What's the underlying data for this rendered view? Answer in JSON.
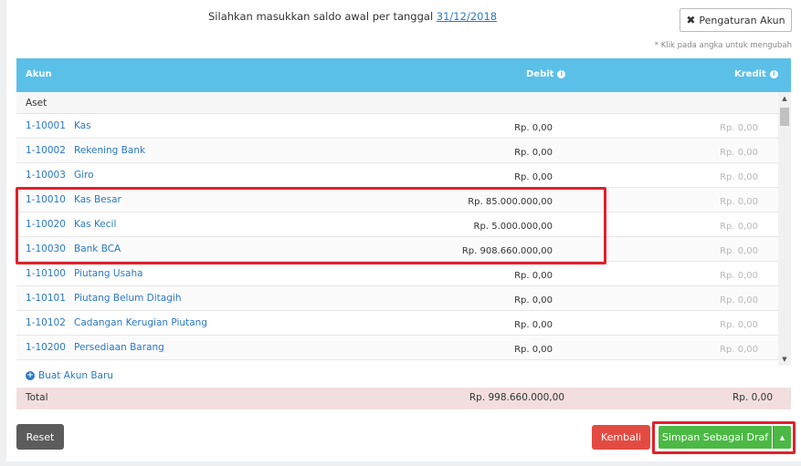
{
  "intro": {
    "text": "Silahkan masukkan saldo awal per tanggal",
    "date": "31/12/2018"
  },
  "settings_button": {
    "label": "Pengaturan Akun"
  },
  "hint": "* Klik pada angka untuk mengubah",
  "table": {
    "headers": {
      "akun": "Akun",
      "debit": "Debit",
      "kredit": "Kredit"
    },
    "group": "Aset",
    "rows": [
      {
        "code": "1-10001",
        "name": "Kas",
        "debit": "Rp. 0,00",
        "kredit": "Rp. 0,00"
      },
      {
        "code": "1-10002",
        "name": "Rekening Bank",
        "debit": "Rp. 0,00",
        "kredit": "Rp. 0,00"
      },
      {
        "code": "1-10003",
        "name": "Giro",
        "debit": "Rp. 0,00",
        "kredit": "Rp. 0,00"
      },
      {
        "code": "1-10010",
        "name": "Kas Besar",
        "debit": "Rp. 85.000.000,00",
        "kredit": "Rp. 0,00"
      },
      {
        "code": "1-10020",
        "name": "Kas Kecil",
        "debit": "Rp. 5.000.000,00",
        "kredit": "Rp. 0,00"
      },
      {
        "code": "1-10030",
        "name": "Bank BCA",
        "debit": "Rp. 908.660.000,00",
        "kredit": "Rp. 0,00"
      },
      {
        "code": "1-10100",
        "name": "Piutang Usaha",
        "debit": "Rp. 0,00",
        "kredit": "Rp. 0,00"
      },
      {
        "code": "1-10101",
        "name": "Piutang Belum Ditagih",
        "debit": "Rp. 0,00",
        "kredit": "Rp. 0,00"
      },
      {
        "code": "1-10102",
        "name": "Cadangan Kerugian Piutang",
        "debit": "Rp. 0,00",
        "kredit": "Rp. 0,00"
      },
      {
        "code": "1-10200",
        "name": "Persediaan Barang",
        "debit": "Rp. 0,00",
        "kredit": "Rp. 0,00"
      }
    ]
  },
  "new_account": "Buat Akun Baru",
  "total": {
    "label": "Total",
    "debit": "Rp. 998.660.000,00",
    "kredit": "Rp. 0,00"
  },
  "buttons": {
    "reset": "Reset",
    "back": "Kembali",
    "draft": "Simpan Sebagai Draf"
  },
  "colors": {
    "header": "#5bc0e8",
    "link": "#2a79c3",
    "danger": "#e34b42",
    "success": "#4cb944",
    "highlight": "#e0212b"
  }
}
